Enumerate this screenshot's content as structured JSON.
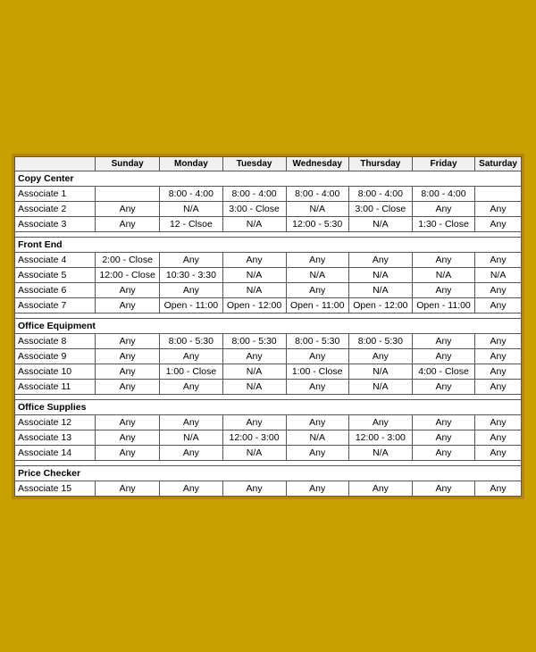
{
  "headers": [
    "",
    "Sunday",
    "Monday",
    "Tuesday",
    "Wednesday",
    "Thursday",
    "Friday",
    "Saturday"
  ],
  "sections": [
    {
      "name": "Copy Center",
      "rows": [
        {
          "label": "Associate 1",
          "cols": [
            "",
            "8:00 - 4:00",
            "8:00 - 4:00",
            "8:00 - 4:00",
            "8:00 - 4:00",
            "8:00 - 4:00",
            ""
          ]
        },
        {
          "label": "Associate 2",
          "cols": [
            "Any",
            "N/A",
            "3:00 - Close",
            "N/A",
            "3:00 - Close",
            "Any",
            "Any"
          ]
        },
        {
          "label": "Associate 3",
          "cols": [
            "Any",
            "12 - Clsoe",
            "N/A",
            "12:00 - 5:30",
            "N/A",
            "1:30 - Close",
            "Any"
          ]
        }
      ]
    },
    {
      "name": "Front End",
      "rows": [
        {
          "label": "Associate 4",
          "cols": [
            "2:00 - Close",
            "Any",
            "Any",
            "Any",
            "Any",
            "Any",
            "Any"
          ]
        },
        {
          "label": "Associate 5",
          "cols": [
            "12:00 - Close",
            "10:30 - 3:30",
            "N/A",
            "N/A",
            "N/A",
            "N/A",
            "N/A"
          ]
        },
        {
          "label": "Associate 6",
          "cols": [
            "Any",
            "Any",
            "N/A",
            "Any",
            "N/A",
            "Any",
            "Any"
          ]
        },
        {
          "label": "Associate 7",
          "cols": [
            "Any",
            "Open - 11:00",
            "Open - 12:00",
            "Open - 11:00",
            "Open - 12:00",
            "Open - 11:00",
            "Any"
          ]
        }
      ]
    },
    {
      "name": "Office Equipment",
      "rows": [
        {
          "label": "Associate 8",
          "cols": [
            "Any",
            "8:00 - 5:30",
            "8:00 - 5:30",
            "8:00 - 5:30",
            "8:00 - 5:30",
            "Any",
            "Any"
          ]
        },
        {
          "label": "Associate 9",
          "cols": [
            "Any",
            "Any",
            "Any",
            "Any",
            "Any",
            "Any",
            "Any"
          ]
        },
        {
          "label": "Associate 10",
          "cols": [
            "Any",
            "1:00 - Close",
            "N/A",
            "1:00 - Close",
            "N/A",
            "4:00 - Close",
            "Any"
          ]
        },
        {
          "label": "Associate 11",
          "cols": [
            "Any",
            "Any",
            "N/A",
            "Any",
            "N/A",
            "Any",
            "Any"
          ]
        }
      ]
    },
    {
      "name": "Office Supplies",
      "rows": [
        {
          "label": "Associate 12",
          "cols": [
            "Any",
            "Any",
            "Any",
            "Any",
            "Any",
            "Any",
            "Any"
          ]
        },
        {
          "label": "Associate 13",
          "cols": [
            "Any",
            "N/A",
            "12:00 - 3:00",
            "N/A",
            "12:00 - 3:00",
            "Any",
            "Any"
          ]
        },
        {
          "label": "Associate 14",
          "cols": [
            "Any",
            "Any",
            "N/A",
            "Any",
            "N/A",
            "Any",
            "Any"
          ]
        }
      ]
    },
    {
      "name": "Price Checker",
      "rows": [
        {
          "label": "Associate 15",
          "cols": [
            "Any",
            "Any",
            "Any",
            "Any",
            "Any",
            "Any",
            "Any"
          ]
        }
      ]
    }
  ]
}
